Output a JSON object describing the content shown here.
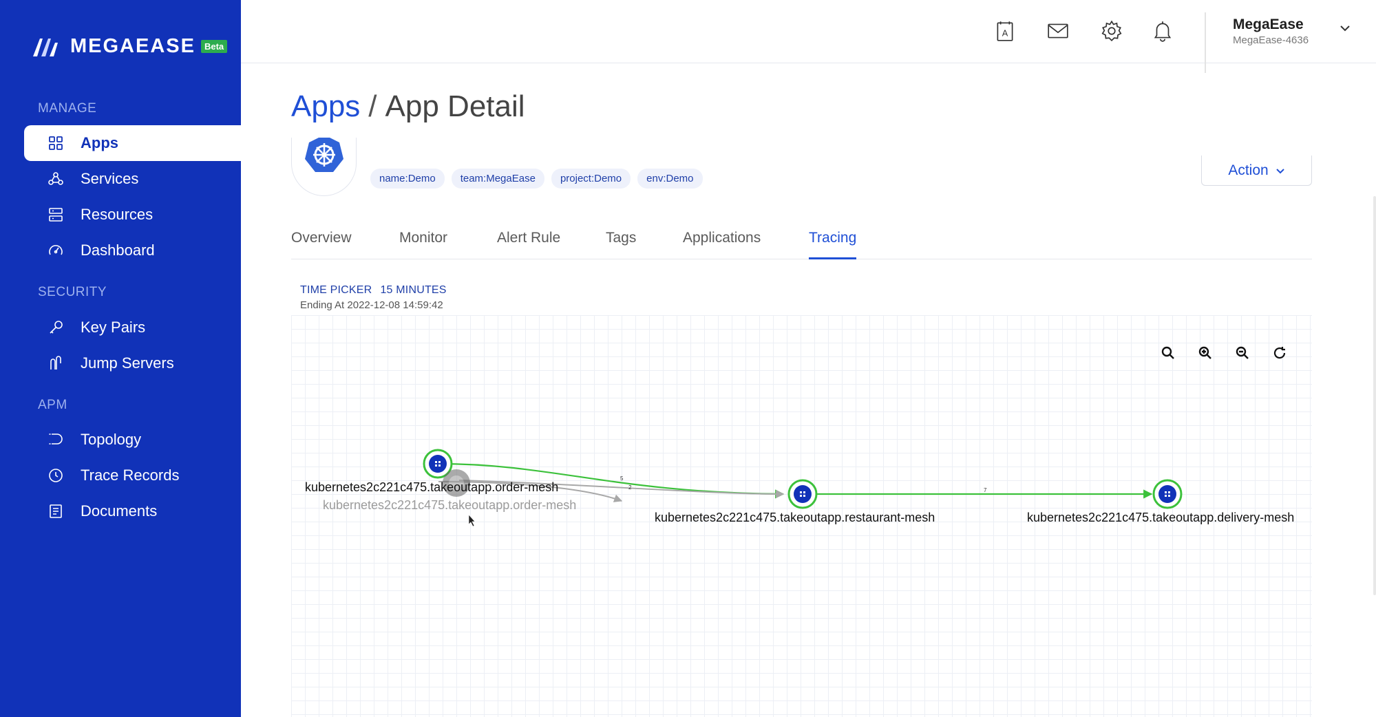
{
  "brand": {
    "name": "MEGAEASE",
    "badge": "Beta"
  },
  "sidebar": {
    "sections": [
      {
        "label": "MANAGE"
      },
      {
        "label": "SECURITY"
      },
      {
        "label": "APM"
      }
    ],
    "items": [
      {
        "label": "Apps",
        "icon": "grid-icon",
        "active": true
      },
      {
        "label": "Services",
        "icon": "services-icon"
      },
      {
        "label": "Resources",
        "icon": "server-icon"
      },
      {
        "label": "Dashboard",
        "icon": "gauge-icon"
      },
      {
        "label": "Key Pairs",
        "icon": "key-icon"
      },
      {
        "label": "Jump Servers",
        "icon": "jump-icon"
      },
      {
        "label": "Topology",
        "icon": "topology-icon"
      },
      {
        "label": "Trace Records",
        "icon": "clock-icon"
      },
      {
        "label": "Documents",
        "icon": "document-icon"
      }
    ]
  },
  "header": {
    "icons": [
      "contact-card-icon",
      "mail-icon",
      "gear-icon",
      "bell-icon"
    ],
    "user": {
      "name": "MegaEase",
      "account": "MegaEase-4636"
    }
  },
  "breadcrumb": {
    "parent": "Apps",
    "separator": "/",
    "current": "App Detail"
  },
  "app": {
    "icon": "kubernetes-icon",
    "tags": [
      "name:Demo",
      "team:MegaEase",
      "project:Demo",
      "env:Demo"
    ],
    "action_label": "Action"
  },
  "tabs": [
    {
      "label": "Overview"
    },
    {
      "label": "Monitor"
    },
    {
      "label": "Alert Rule"
    },
    {
      "label": "Tags"
    },
    {
      "label": "Applications"
    },
    {
      "label": "Tracing",
      "active": true
    }
  ],
  "time_picker": {
    "label": "TIME PICKER",
    "value": "15 MINUTES",
    "ending": "Ending At 2022-12-08 14:59:42"
  },
  "graph": {
    "toolbar": [
      "search-icon",
      "zoom-in-icon",
      "zoom-out-icon",
      "reset-icon"
    ],
    "nodes": [
      {
        "label": "kubernetes2c221c475.takeoutapp.order-mesh"
      },
      {
        "label": "kubernetes2c221c475.takeoutapp.order-mesh",
        "ghost": true
      },
      {
        "label": "kubernetes2c221c475.takeoutapp.restaurant-mesh"
      },
      {
        "label": "kubernetes2c221c475.takeoutapp.delivery-mesh"
      }
    ],
    "edges": [
      {
        "label": "5"
      },
      {
        "label": "2"
      },
      {
        "label": "7"
      }
    ],
    "colors": {
      "edge": "#3cc13b",
      "ghost_edge": "#a8a8a8",
      "node": "#1132b8"
    }
  }
}
